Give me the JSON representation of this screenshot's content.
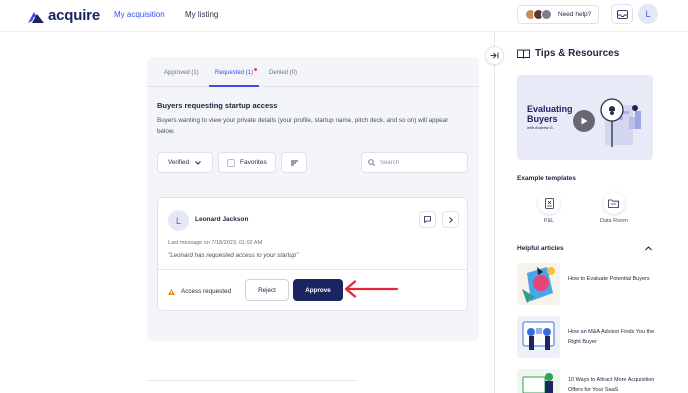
{
  "brand": {
    "name": "acquire",
    "color": "#1c2461",
    "accent": "#3b4bf0"
  },
  "nav": {
    "my_acquisition": "My acquisition",
    "my_listing": "My listing"
  },
  "header": {
    "help_label": "Need help?",
    "user_initial": "L"
  },
  "tabs": [
    {
      "label": "Approved (1)",
      "active": false
    },
    {
      "label": "Requested (1)",
      "active": true,
      "has_notification_dot": true
    },
    {
      "label": "Denied (0)",
      "active": false
    }
  ],
  "section": {
    "title": "Buyers requesting startup access",
    "description": "Buyers wanting to view your private details (your profile, startup name, pitch deck, and so on) will appear below."
  },
  "filters": {
    "verified_label": "Verified",
    "favorites_label": "Favorites",
    "search_placeholder": "Search"
  },
  "request": {
    "initial": "L",
    "buyer_name": "Leonard Jackson",
    "last_message": "Last message on 7/18/2023, 01:02 AM",
    "message": "\"Leonard has requested access to your startup\"",
    "status": "Access requested",
    "reject_label": "Reject",
    "approve_label": "Approve"
  },
  "resources": {
    "title": "Tips & Resources",
    "video": {
      "title_line1": "Evaluating",
      "title_line2": "Buyers",
      "subtitle": "with Andrew G."
    },
    "templates_title": "Example templates",
    "templates": [
      {
        "label": "P&L",
        "icon": "document-dollar-icon"
      },
      {
        "label": "Data Room",
        "icon": "folder-icon"
      }
    ],
    "articles_title": "Helpful articles",
    "articles": [
      {
        "title": "How to Evaluate Potential Buyers"
      },
      {
        "title": "How an M&A Advisor Finds You the Right Buyer"
      },
      {
        "title": "10 Ways to Attract More Acquisition Offers for Your SaaS"
      }
    ]
  },
  "colors": {
    "approve": "#1c2461",
    "warning": "#f08a24",
    "annotation_arrow": "#e0283a",
    "notification_dot": "#ef3d5a"
  }
}
